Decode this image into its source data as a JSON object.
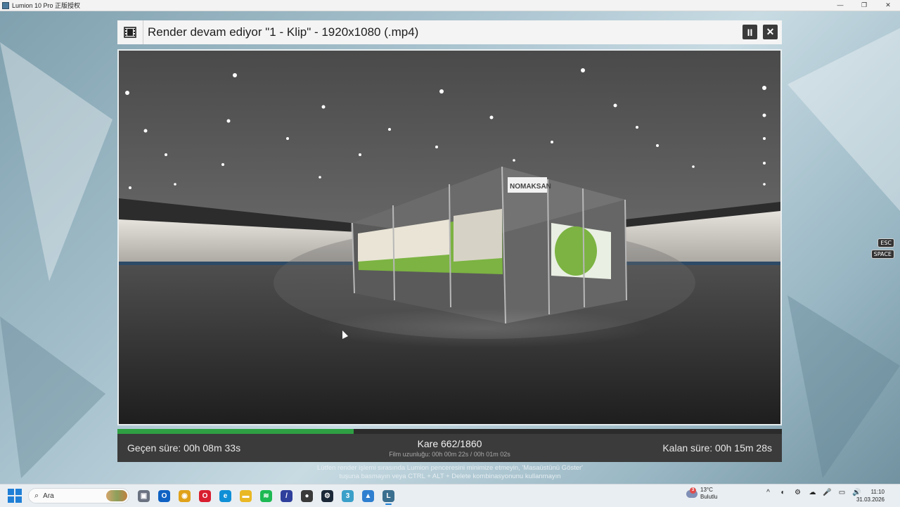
{
  "app_window": {
    "title": "Lumion 10 Pro 正版授权",
    "minimize": "—",
    "restore": "❐",
    "close": "✕"
  },
  "render_dialog": {
    "title": "Render devam ediyor \"1 - Klip\" - 1920x1080 (.mp4)",
    "pause_label": "II",
    "close_label": "✕",
    "progress": 0.356,
    "elapsed": "Geçen süre: 00h 08m 33s",
    "frame": "Kare 662/1860",
    "film_length": "Film uzunluğu: 00h 00m 22s / 00h 01m 02s",
    "remaining": "Kalan süre: 00h 15m 28s",
    "warning_line1": "Lütfen render işlemi sırasında Lumion penceresini minimize etmeyin, 'Masaüstünü Göster'",
    "warning_line2": "tuşuna basmayın veya CTRL + ALT + Delete kombinasyonunu kullanmayın",
    "booth_brand": "NOMAKSAN"
  },
  "shortcuts": {
    "esc": "ESC",
    "space": "SPACE"
  },
  "taskbar": {
    "search_placeholder": "Ara",
    "apps": [
      {
        "name": "task-view",
        "color": "#6b7280",
        "glyph": "▣"
      },
      {
        "name": "outlook",
        "color": "#0f62c3",
        "glyph": "O"
      },
      {
        "name": "chrome",
        "color": "#e0a21a",
        "glyph": "◉"
      },
      {
        "name": "opera",
        "color": "#d81e2f",
        "glyph": "O"
      },
      {
        "name": "edge",
        "color": "#0f8fd6",
        "glyph": "e"
      },
      {
        "name": "file-explorer",
        "color": "#e9b824",
        "glyph": "▬"
      },
      {
        "name": "spotify",
        "color": "#1db954",
        "glyph": "≋"
      },
      {
        "name": "winrar",
        "color": "#2f3f9c",
        "glyph": "/"
      },
      {
        "name": "obs",
        "color": "#3a3a3a",
        "glyph": "●"
      },
      {
        "name": "steam",
        "color": "#1b2838",
        "glyph": "⚙"
      },
      {
        "name": "app-blue",
        "color": "#3aa0c9",
        "glyph": "3"
      },
      {
        "name": "app-image",
        "color": "#2f7fd0",
        "glyph": "▲"
      },
      {
        "name": "lumion",
        "color": "#3b6f8f",
        "glyph": "L"
      }
    ],
    "weather_temp": "13°C",
    "weather_desc": "Bulutlu",
    "weather_badge": "3",
    "tray_icons": [
      "^",
      "◐",
      "⚙",
      "☁",
      "🎤",
      "▭",
      "🔊"
    ],
    "time": "11:10",
    "date": "31.03.2026"
  }
}
